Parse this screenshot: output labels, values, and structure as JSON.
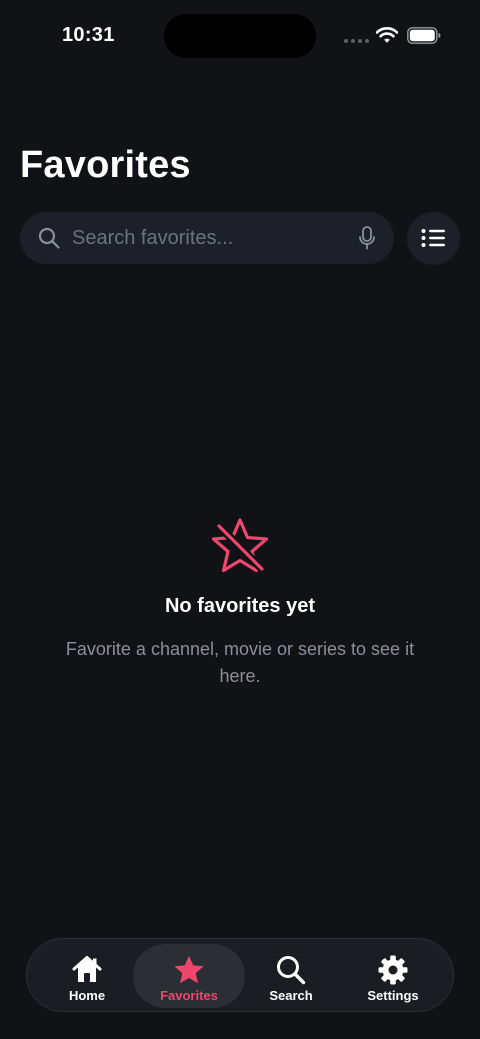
{
  "status_bar": {
    "time": "10:31"
  },
  "header": {
    "title": "Favorites"
  },
  "search": {
    "placeholder": "Search favorites..."
  },
  "empty_state": {
    "title": "No favorites yet",
    "message": "Favorite a channel, movie or series to see it here."
  },
  "tab_bar": {
    "items": [
      {
        "label": "Home",
        "icon": "home-icon",
        "active": false
      },
      {
        "label": "Favorites",
        "icon": "star-icon",
        "active": true
      },
      {
        "label": "Search",
        "icon": "search-icon",
        "active": false
      },
      {
        "label": "Settings",
        "icon": "gear-icon",
        "active": false
      }
    ]
  },
  "colors": {
    "background": "#111216",
    "surface": "#1d2029",
    "accent": "#f0466e",
    "muted_text": "#8b8f99"
  }
}
